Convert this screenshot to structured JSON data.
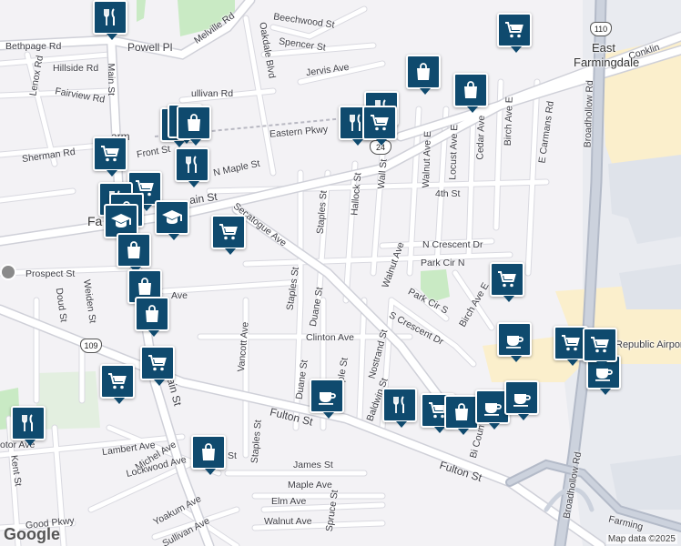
{
  "map": {
    "streets": [
      {
        "id": "melville-rd",
        "text": "Melville Rd"
      },
      {
        "id": "beechwood-st",
        "text": "Beechwood St"
      },
      {
        "id": "bethpage-rd",
        "text": "Bethpage Rd"
      },
      {
        "id": "powell-pl",
        "text": "Powell Pl"
      },
      {
        "id": "spencer-st",
        "text": "Spencer St"
      },
      {
        "id": "oakdale-blvd",
        "text": "Oakdale Blvd"
      },
      {
        "id": "hillside-rd",
        "text": "Hillside Rd"
      },
      {
        "id": "lenox-rd",
        "text": "Lenox Rd"
      },
      {
        "id": "main-st-1",
        "text": "Main St"
      },
      {
        "id": "jervis-ave",
        "text": "Jervis Ave"
      },
      {
        "id": "fairview-rd",
        "text": "Fairview Rd"
      },
      {
        "id": "sullivan-rd",
        "text": "ullivan Rd"
      },
      {
        "id": "eastern-pkwy",
        "text": "Eastern Pkwy"
      },
      {
        "id": "sherman-rd",
        "text": "Sherman Rd"
      },
      {
        "id": "front-st",
        "text": "Front St"
      },
      {
        "id": "n-maple-st",
        "text": "N Maple St"
      },
      {
        "id": "conklin",
        "text": "Conklin"
      },
      {
        "id": "walnut-ave-e",
        "text": "Walnut Ave E"
      },
      {
        "id": "locust-ave-e",
        "text": "Locust Ave E"
      },
      {
        "id": "cedar-ave",
        "text": "Cedar Ave"
      },
      {
        "id": "birch-ave-e",
        "text": "Birch Ave E"
      },
      {
        "id": "e-carmans-rd",
        "text": "E Carmans Rd"
      },
      {
        "id": "broadhollow-rd-1",
        "text": "Broadhollow Rd"
      },
      {
        "id": "wall-st",
        "text": "Wall St"
      },
      {
        "id": "hallock-st",
        "text": "Hallock St"
      },
      {
        "id": "staples-st-1",
        "text": "Staples St"
      },
      {
        "id": "fourth-st",
        "text": "4th St"
      },
      {
        "id": "main-st-2",
        "text": "ain St"
      },
      {
        "id": "secatogue-ave",
        "text": "Secatogue Ave"
      },
      {
        "id": "n-crescent-dr",
        "text": "N Crescent Dr"
      },
      {
        "id": "walnut-ave",
        "text": "Walnut Ave"
      },
      {
        "id": "park-cir-n",
        "text": "Park Cir N"
      },
      {
        "id": "prospect-st",
        "text": "Prospect St"
      },
      {
        "id": "staples-st-2",
        "text": "Staples St"
      },
      {
        "id": "duane-st-1",
        "text": "Duane St"
      },
      {
        "id": "ave-1",
        "text": "Ave"
      },
      {
        "id": "doud-st",
        "text": "Doud St"
      },
      {
        "id": "weiden-st",
        "text": "Weiden St"
      },
      {
        "id": "park-cir-s",
        "text": "Park Cir S"
      },
      {
        "id": "birch-ave-e-2",
        "text": "Birch Ave E"
      },
      {
        "id": "s-crescent-dr",
        "text": "S Crescent Dr"
      },
      {
        "id": "vancott-ave",
        "text": "Vancott Ave"
      },
      {
        "id": "clinton-ave",
        "text": "Clinton Ave"
      },
      {
        "id": "nostrand-st",
        "text": "Nostrand St"
      },
      {
        "id": "republic-airport",
        "text": "Republic Airpor"
      },
      {
        "id": "duane-st-2",
        "text": "Duane St"
      },
      {
        "id": "maple-st",
        "text": "aple St"
      },
      {
        "id": "main-st-3",
        "text": "Main St"
      },
      {
        "id": "baldwin-st",
        "text": "Baldwin St"
      },
      {
        "id": "fulton-st-1",
        "text": "Fulton St"
      },
      {
        "id": "staples-st-3",
        "text": "Staples St"
      },
      {
        "id": "lambert-ave",
        "text": "Lambert Ave"
      },
      {
        "id": "michel-ave",
        "text": "Michel Ave"
      },
      {
        "id": "lockwood-ave",
        "text": "Lockwood Ave"
      },
      {
        "id": "st-1",
        "text": "St"
      },
      {
        "id": "james-st",
        "text": "James St"
      },
      {
        "id": "bi-coun",
        "text": "Bi Coun"
      },
      {
        "id": "fulton-st-2",
        "text": "Fulton St"
      },
      {
        "id": "broadhollow-rd-2",
        "text": "Broadhollow Rd"
      },
      {
        "id": "motor-ave",
        "text": "otor Ave"
      },
      {
        "id": "kent-st",
        "text": "Kent St"
      },
      {
        "id": "maple-ave",
        "text": "Maple Ave"
      },
      {
        "id": "elm-ave",
        "text": "Elm Ave"
      },
      {
        "id": "yoakum-ave",
        "text": "Yoakum Ave"
      },
      {
        "id": "spruce-st",
        "text": "Spruce St"
      },
      {
        "id": "walnut-ave-2",
        "text": "Walnut Ave"
      },
      {
        "id": "sullivan-ave",
        "text": "Sullivan Ave"
      },
      {
        "id": "good-pkwy",
        "text": "Good Pkwy"
      },
      {
        "id": "farming",
        "text": "Farming"
      }
    ],
    "places": [
      {
        "id": "east-farmingdale-1",
        "text": "East"
      },
      {
        "id": "east-farmingdale-2",
        "text": "Farmingdale"
      },
      {
        "id": "farmingdale",
        "text": "Fa"
      },
      {
        "id": "farm-partial",
        "text": "arm"
      }
    ],
    "route_shields": [
      "110",
      "24",
      "109"
    ],
    "brand": "Google",
    "copyright": "Map data ©2025",
    "colors": {
      "background": "#f3f2f5",
      "road_major": "#ffffff",
      "road_outline": "#d4d4dc",
      "highway": "#c4cad6",
      "park": "#c9eac4",
      "airport": "#fbefcc",
      "pin": "#0f4a6e"
    },
    "pins": [
      {
        "id": "p1",
        "icon": "restaurant-icon"
      },
      {
        "id": "p2",
        "icon": "grocery-cart-icon"
      },
      {
        "id": "p3",
        "icon": "shopping-bag-icon"
      },
      {
        "id": "p4",
        "icon": "shopping-bag-icon"
      },
      {
        "id": "p5",
        "icon": "restaurant-icon"
      },
      {
        "id": "p6",
        "icon": "restaurant-icon"
      },
      {
        "id": "p7",
        "icon": "shopping-bag-icon"
      },
      {
        "id": "p8",
        "icon": "shopping-bag-icon"
      },
      {
        "id": "p9",
        "icon": "grocery-cart-icon"
      },
      {
        "id": "p10",
        "icon": "restaurant-icon"
      },
      {
        "id": "p11",
        "icon": "restaurant-icon"
      },
      {
        "id": "p12",
        "icon": "grocery-cart-icon"
      },
      {
        "id": "p13",
        "icon": "grocery-cart-icon"
      },
      {
        "id": "p14",
        "icon": "restaurant-icon"
      },
      {
        "id": "p15",
        "icon": "shopping-bag-icon"
      },
      {
        "id": "p16",
        "icon": "graduation-cap-icon"
      },
      {
        "id": "p17",
        "icon": "graduation-cap-icon"
      },
      {
        "id": "p18",
        "icon": "grocery-cart-icon"
      },
      {
        "id": "p19",
        "icon": "shopping-bag-icon"
      },
      {
        "id": "p20",
        "icon": "shopping-bag-icon"
      },
      {
        "id": "p21",
        "icon": "shopping-bag-icon"
      },
      {
        "id": "p22",
        "icon": "grocery-cart-icon"
      },
      {
        "id": "p23",
        "icon": "grocery-cart-icon"
      },
      {
        "id": "p24",
        "icon": "restaurant-icon"
      },
      {
        "id": "p25",
        "icon": "coffee-cup-icon"
      },
      {
        "id": "p26",
        "icon": "restaurant-icon"
      },
      {
        "id": "p27",
        "icon": "grocery-cart-icon"
      },
      {
        "id": "p28",
        "icon": "shopping-bag-icon"
      },
      {
        "id": "p29",
        "icon": "coffee-cup-icon"
      },
      {
        "id": "p30",
        "icon": "coffee-cup-icon"
      },
      {
        "id": "p31",
        "icon": "coffee-cup-icon"
      },
      {
        "id": "p32",
        "icon": "grocery-cart-icon"
      },
      {
        "id": "p33",
        "icon": "coffee-cup-icon"
      },
      {
        "id": "p34",
        "icon": "grocery-cart-icon"
      },
      {
        "id": "p35",
        "icon": "grocery-cart-icon"
      },
      {
        "id": "p36",
        "icon": "shopping-bag-icon"
      }
    ]
  }
}
